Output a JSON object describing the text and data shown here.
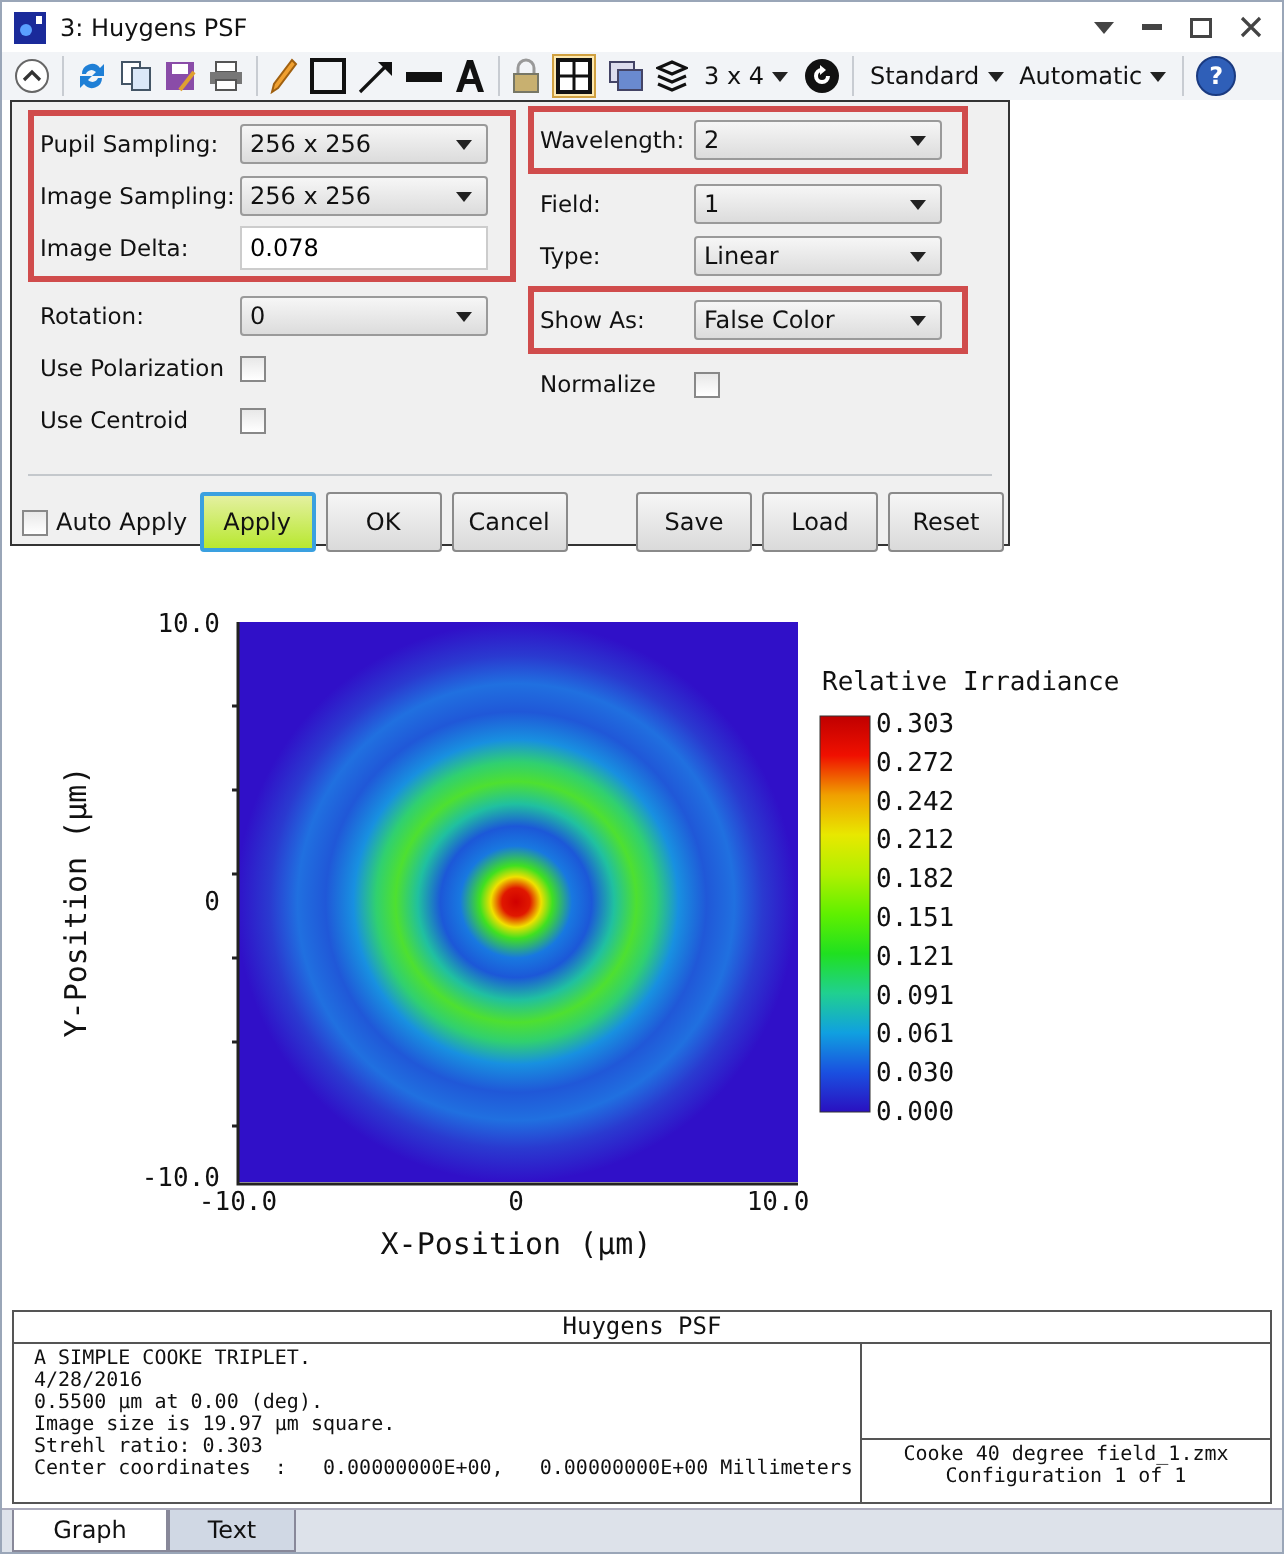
{
  "window": {
    "title": "3: Huygens PSF"
  },
  "toolbar": {
    "grid_toggle": {
      "on": true
    },
    "layout_button": {
      "label": "3 x 4"
    },
    "dropdowns": [
      "Standard",
      "Automatic"
    ],
    "help_label": "?"
  },
  "settings": {
    "columns": [
      {
        "sections": [
          {
            "highlighted": true,
            "rows": [
              {
                "kind": "dropdown",
                "label": "Pupil Sampling:",
                "value": "256 x 256"
              },
              {
                "kind": "dropdown",
                "label": "Image Sampling:",
                "value": "256 x 256"
              },
              {
                "kind": "input",
                "label": "Image Delta:",
                "value": "0.078"
              }
            ]
          },
          {
            "highlighted": false,
            "rows": [
              {
                "kind": "dropdown",
                "label": "Rotation:",
                "value": "0"
              },
              {
                "kind": "checkbox",
                "label": "Use Polarization",
                "checked": false
              },
              {
                "kind": "checkbox",
                "label": "Use Centroid",
                "checked": false
              }
            ]
          }
        ]
      },
      {
        "sections": [
          {
            "highlighted": true,
            "rows": [
              {
                "kind": "dropdown",
                "label": "Wavelength:",
                "value": "2"
              }
            ]
          },
          {
            "highlighted": false,
            "rows": [
              {
                "kind": "dropdown",
                "label": "Field:",
                "value": "1"
              },
              {
                "kind": "dropdown",
                "label": "Type:",
                "value": "Linear"
              }
            ]
          },
          {
            "highlighted": true,
            "rows": [
              {
                "kind": "dropdown",
                "label": "Show As:",
                "value": "False Color"
              }
            ]
          },
          {
            "highlighted": false,
            "rows": [
              {
                "kind": "checkbox",
                "label": "Normalize",
                "checked": false
              }
            ]
          }
        ]
      }
    ],
    "auto_apply": {
      "label": "Auto Apply",
      "checked": false
    },
    "buttons": [
      {
        "label": "Apply",
        "highlighted": true
      },
      {
        "label": "OK",
        "highlighted": false
      },
      {
        "label": "Cancel",
        "highlighted": false
      }
    ],
    "file_buttons": [
      "Save",
      "Load",
      "Reset"
    ]
  },
  "plot": {
    "y_ticks": [
      "10.0",
      "0",
      "-10.0"
    ],
    "x_ticks": [
      "-10.0",
      "0",
      "10.0"
    ],
    "xlabel": "X-Position (µm)",
    "ylabel": "Y-Position (µm)",
    "legend": {
      "title": "Relative Irradiance",
      "labels": [
        "0.303",
        "0.272",
        "0.242",
        "0.212",
        "0.182",
        "0.151",
        "0.121",
        "0.091",
        "0.061",
        "0.030",
        "0.000"
      ]
    }
  },
  "text_block": {
    "title": "Huygens PSF",
    "lines": [
      "A SIMPLE COOKE TRIPLET.",
      "4/28/2016",
      "0.5500 µm at 0.00 (deg).",
      "Image size is 19.97 µm square.",
      "Strehl ratio: 0.303",
      "Center coordinates  :   0.00000000E+00,   0.00000000E+00 Millimeters"
    ],
    "file_lines": [
      "Cooke 40 degree field_1.zmx",
      "Configuration 1 of 1"
    ]
  },
  "tabs": [
    {
      "label": "Graph",
      "selected": true
    },
    {
      "label": "Text",
      "selected": false
    }
  ]
}
